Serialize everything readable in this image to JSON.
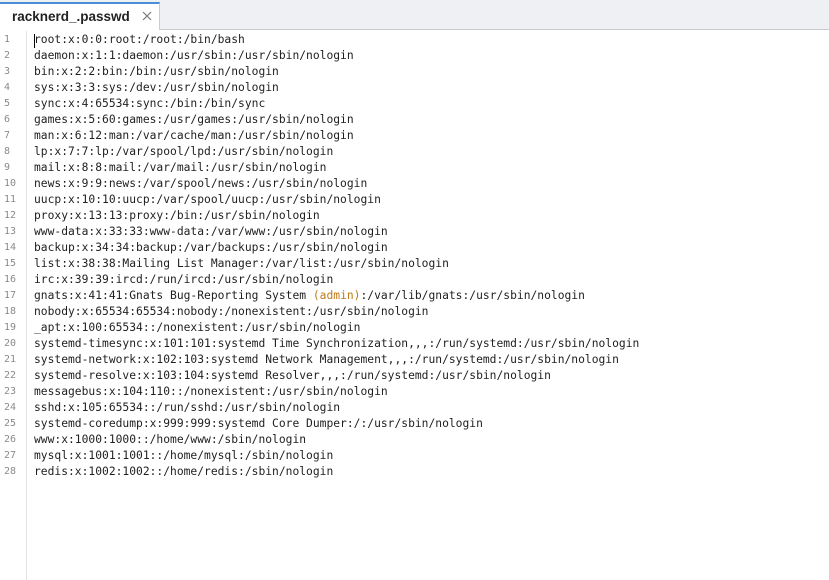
{
  "tab": {
    "title": "racknerd_.passwd",
    "close_glyph": "×"
  },
  "editor": {
    "line_numbers": [
      "1",
      "2",
      "3",
      "4",
      "5",
      "6",
      "7",
      "8",
      "9",
      "10",
      "11",
      "12",
      "13",
      "14",
      "15",
      "16",
      "17",
      "18",
      "19",
      "20",
      "21",
      "22",
      "23",
      "24",
      "25",
      "26",
      "27",
      "28"
    ],
    "lines": [
      "root:x:0:0:root:/root:/bin/bash",
      "daemon:x:1:1:daemon:/usr/sbin:/usr/sbin/nologin",
      "bin:x:2:2:bin:/bin:/usr/sbin/nologin",
      "sys:x:3:3:sys:/dev:/usr/sbin/nologin",
      "sync:x:4:65534:sync:/bin:/bin/sync",
      "games:x:5:60:games:/usr/games:/usr/sbin/nologin",
      "man:x:6:12:man:/var/cache/man:/usr/sbin/nologin",
      "lp:x:7:7:lp:/var/spool/lpd:/usr/sbin/nologin",
      "mail:x:8:8:mail:/var/mail:/usr/sbin/nologin",
      "news:x:9:9:news:/var/spool/news:/usr/sbin/nologin",
      "uucp:x:10:10:uucp:/var/spool/uucp:/usr/sbin/nologin",
      "proxy:x:13:13:proxy:/bin:/usr/sbin/nologin",
      "www-data:x:33:33:www-data:/var/www:/usr/sbin/nologin",
      "backup:x:34:34:backup:/var/backups:/usr/sbin/nologin",
      "list:x:38:38:Mailing List Manager:/var/list:/usr/sbin/nologin",
      "irc:x:39:39:ircd:/run/ircd:/usr/sbin/nologin",
      "gnats:x:41:41:Gnats Bug-Reporting System ",
      "nobody:x:65534:65534:nobody:/nonexistent:/usr/sbin/nologin",
      "_apt:x:100:65534::/nonexistent:/usr/sbin/nologin",
      "systemd-timesync:x:101:101:systemd Time Synchronization,,,:/run/systemd:/usr/sbin/nologin",
      "systemd-network:x:102:103:systemd Network Management,,,:/run/systemd:/usr/sbin/nologin",
      "systemd-resolve:x:103:104:systemd Resolver,,,:/run/systemd:/usr/sbin/nologin",
      "messagebus:x:104:110::/nonexistent:/usr/sbin/nologin",
      "sshd:x:105:65534::/run/sshd:/usr/sbin/nologin",
      "systemd-coredump:x:999:999:systemd Core Dumper:/:/usr/sbin/nologin",
      "www:x:1000:1000::/home/www:/sbin/nologin",
      "mysql:x:1001:1001::/home/mysql:/sbin/nologin",
      "redis:x:1002:1002::/home/redis:/sbin/nologin"
    ],
    "line17_highlight": "(admin)",
    "line17_tail": ":/var/lib/gnats:/usr/sbin/nologin"
  },
  "colors": {
    "highlight": "#c07a16",
    "tab_accent": "#4a90d9"
  }
}
